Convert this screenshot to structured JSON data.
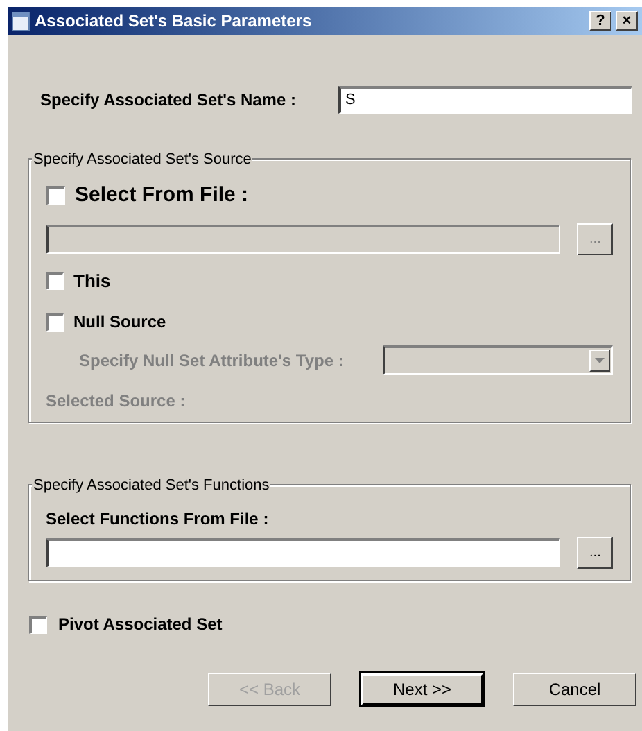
{
  "window": {
    "title": "Associated Set's Basic Parameters",
    "title_buttons": [
      "?",
      "×"
    ]
  },
  "name": {
    "label": "Specify Associated Set's Name :",
    "value": "S"
  },
  "source": {
    "legend": "Specify Associated Set's Source",
    "select_from_file": {
      "label": "Select From File :",
      "checked": false
    },
    "file_field": {
      "disabled": true
    },
    "browse": "...",
    "this": {
      "label": "This",
      "checked": false
    },
    "null_source": {
      "label": "Null Source",
      "checked": false
    },
    "null_type": {
      "label": "Specify Null Set Attribute's Type :",
      "disabled": true
    },
    "selected_source": {
      "label": "Selected Source :",
      "disabled": true
    }
  },
  "functions": {
    "legend": "Specify Associated Set's Functions",
    "label": "Select Functions From File :",
    "browse": "..."
  },
  "pivot": {
    "label": "Pivot Associated Set",
    "checked": false
  },
  "buttons": [
    {
      "label": "<< Back",
      "disabled": true,
      "default": false
    },
    {
      "label": "Next >>",
      "disabled": false,
      "default": true
    },
    {
      "label": "Cancel",
      "disabled": false,
      "default": false
    }
  ]
}
